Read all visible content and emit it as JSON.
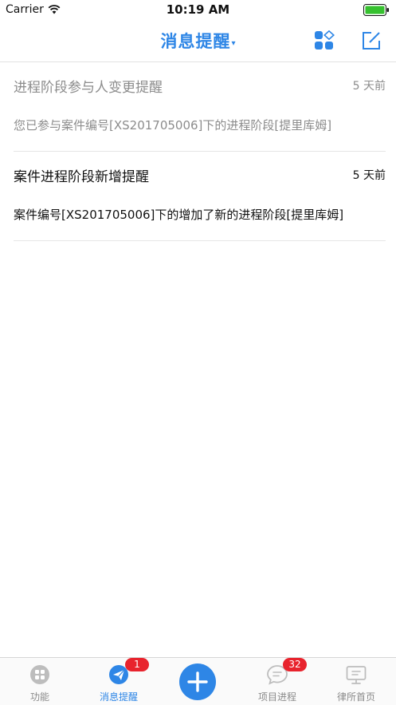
{
  "status_bar": {
    "carrier": "Carrier",
    "time": "10:19 AM"
  },
  "nav": {
    "title": "消息提醒",
    "caret": "▾",
    "accent": "#2e86e6"
  },
  "messages": [
    {
      "title": "进程阶段参与人变更提醒",
      "time": "5 天前",
      "body": "您已参与案件编号[XS201705006]下的进程阶段[提里库姆]",
      "state": "read"
    },
    {
      "title": "案件进程阶段新增提醒",
      "time": "5 天前",
      "body": "案件编号[XS201705006]下的增加了新的进程阶段[提里库姆]",
      "state": "unread"
    }
  ],
  "tabs": [
    {
      "label": "功能",
      "icon": "grid-icon"
    },
    {
      "label": "消息提醒",
      "icon": "paper-plane-icon",
      "badge": "1",
      "active": true
    },
    {
      "label": "",
      "icon": "plus-icon"
    },
    {
      "label": "项目进程",
      "icon": "chat-icon",
      "badge": "32"
    },
    {
      "label": "律所首页",
      "icon": "monitor-icon"
    }
  ],
  "colors": {
    "badge": "#e8232d",
    "read_text": "#8c8c8c"
  }
}
